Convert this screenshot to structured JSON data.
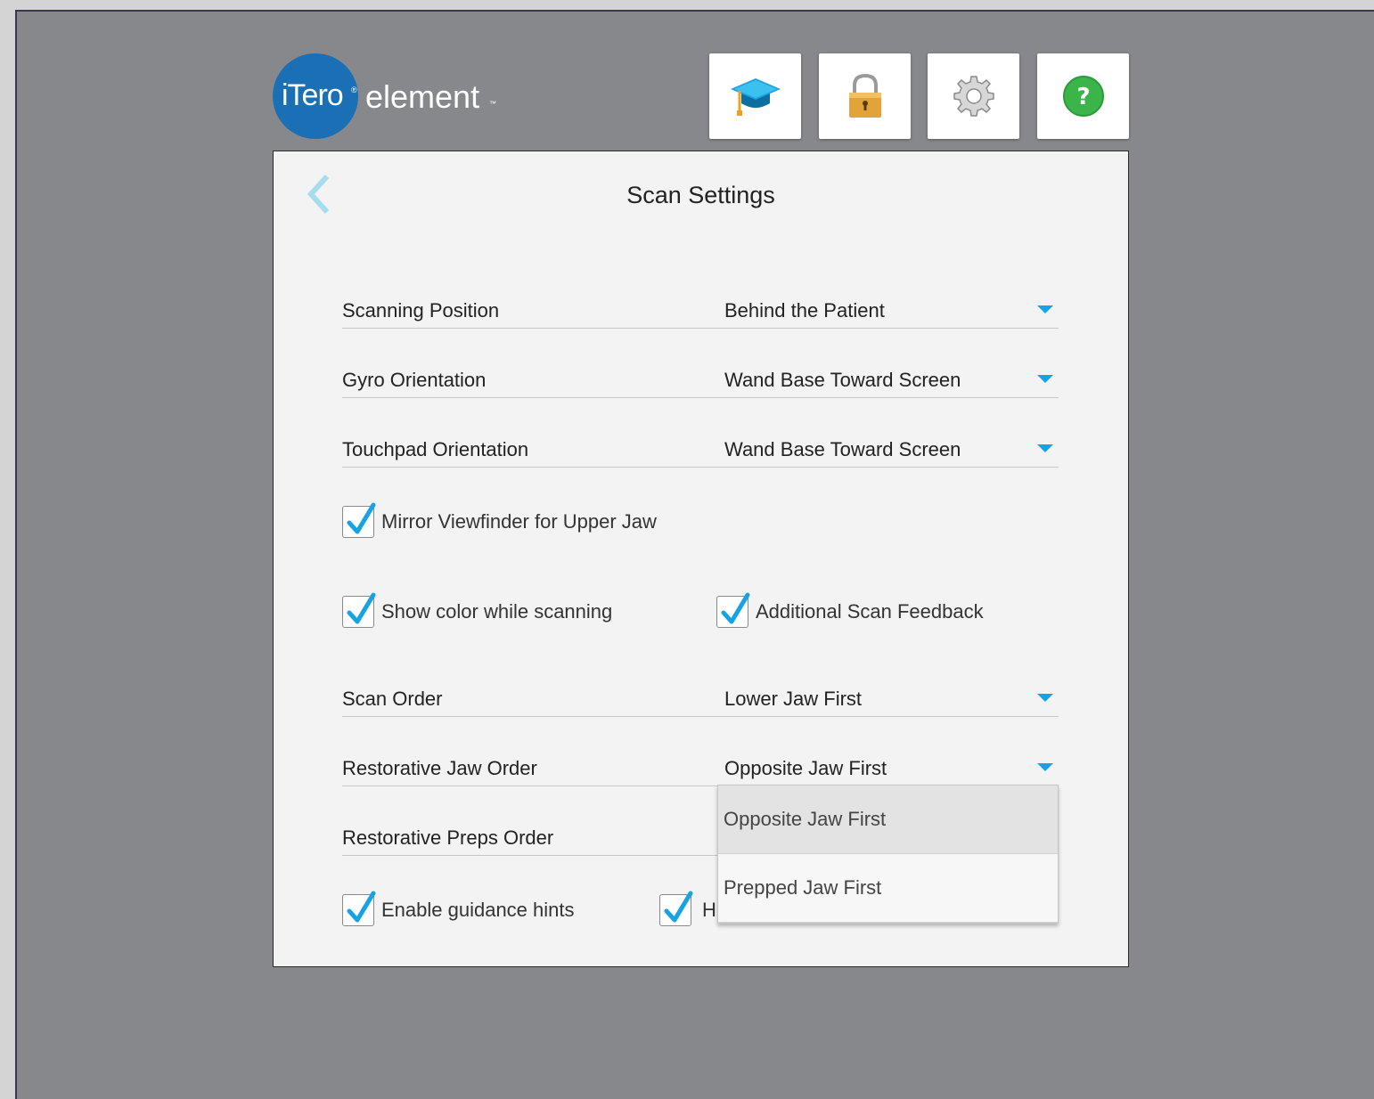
{
  "logo": {
    "brand": "iTero",
    "product": "element",
    "registered": "®",
    "trademark": "™"
  },
  "toolbar": {
    "items": [
      {
        "name": "learning-center",
        "icon": "graduation-cap-icon"
      },
      {
        "name": "lock",
        "icon": "padlock-icon"
      },
      {
        "name": "settings",
        "icon": "gear-icon"
      },
      {
        "name": "help",
        "icon": "help-icon"
      }
    ]
  },
  "dialog": {
    "title": "Scan Settings",
    "back_icon": "chevron-left-icon",
    "settings": [
      {
        "label": "Scanning Position",
        "value": "Behind the Patient"
      },
      {
        "label": "Gyro Orientation",
        "value": "Wand Base Toward Screen"
      },
      {
        "label": "Touchpad Orientation",
        "value": "Wand Base Toward Screen"
      },
      {
        "label": "Scan Order",
        "value": "Lower Jaw First"
      },
      {
        "label": "Restorative Jaw Order",
        "value": "Opposite Jaw First"
      },
      {
        "label": "Restorative Preps Order",
        "value": ""
      }
    ],
    "checkboxes": [
      {
        "label": "Mirror Viewfinder for Upper Jaw",
        "checked": true
      },
      {
        "label": "Show color while scanning",
        "checked": true
      },
      {
        "label": "Additional Scan Feedback",
        "checked": true
      },
      {
        "label": "Enable guidance hints",
        "checked": true
      },
      {
        "label": "H",
        "checked": true
      }
    ],
    "dropdown": {
      "options": [
        "Opposite Jaw First",
        "Prepped Jaw First"
      ],
      "selected": "Opposite Jaw First"
    }
  },
  "colors": {
    "accent": "#16a3e6",
    "logo_blue": "#1a6fb5",
    "help_green": "#3bb54a",
    "background": "#87888c"
  }
}
